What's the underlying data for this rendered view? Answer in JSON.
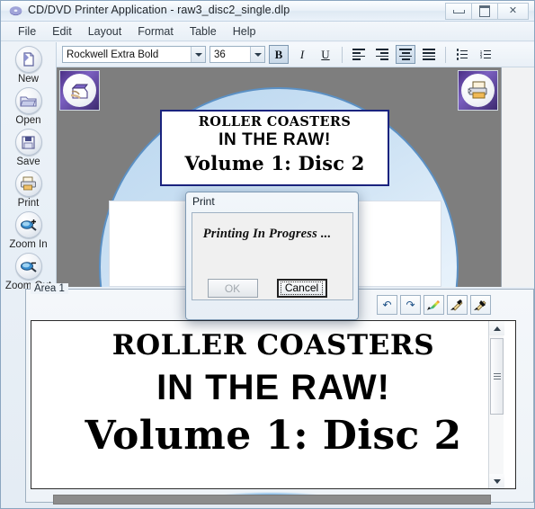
{
  "window": {
    "title": "CD/DVD Printer Application - raw3_disc2_single.dlp",
    "app_icon": "disc-icon",
    "minimize_label": "Minimize",
    "maximize_label": "Restore",
    "close_label": "✕"
  },
  "menubar": {
    "items": [
      {
        "label": "File"
      },
      {
        "label": "Edit"
      },
      {
        "label": "Layout"
      },
      {
        "label": "Format"
      },
      {
        "label": "Table"
      },
      {
        "label": "Help"
      }
    ]
  },
  "format_toolbar": {
    "font_family_value": "Rockwell Extra Bold",
    "font_size_value": "36",
    "bold_label": "B",
    "italic_label": "I",
    "underline_label": "U",
    "align_left": "align-left-icon",
    "align_right": "align-right-icon",
    "align_center": "align-center-icon",
    "align_justify": "align-justify-icon",
    "bullet_list": "bullet-list-icon",
    "numbered_list": "numbered-list-icon",
    "bold_active": true,
    "align_center_active": true
  },
  "sidebar": {
    "items": [
      {
        "label": "New",
        "icon": "new-document-icon"
      },
      {
        "label": "Open",
        "icon": "open-folder-icon"
      },
      {
        "label": "Save",
        "icon": "save-disk-icon"
      },
      {
        "label": "Print",
        "icon": "printer-icon"
      },
      {
        "label": "Zoom In",
        "icon": "zoom-in-icon"
      },
      {
        "label": "Zoom Out",
        "icon": "zoom-out-icon"
      }
    ]
  },
  "preview": {
    "left_icon": "import-image-icon",
    "right_icon": "printer-preview-icon",
    "disc_label_text": {
      "line1": "ROLLER COASTERS",
      "line2": "IN THE RAW!",
      "line3": "Volume 1: Disc 2"
    },
    "colors": {
      "background": "#7e7e7e",
      "disc_fill": "#cde2f4",
      "disc_border": "#5b90c4",
      "textbox_border": "#1a237e"
    }
  },
  "area_panel": {
    "legend": "Area 1",
    "toolbar": [
      {
        "name": "undo-button",
        "glyph": "↶"
      },
      {
        "name": "redo-button",
        "glyph": "↷"
      },
      {
        "name": "gradient-fill-button",
        "glyph": "◢"
      },
      {
        "name": "text-color-button",
        "glyph": "▼"
      },
      {
        "name": "fill-color-button",
        "glyph": "◆"
      }
    ],
    "editor_text": {
      "line1": "ROLLER COASTERS",
      "line2": "IN THE RAW!",
      "line3": "Volume 1: Disc 2"
    },
    "scroll_up": "scroll-up-arrow",
    "scroll_down": "scroll-down-arrow"
  },
  "print_dialog": {
    "title": "Print",
    "message": "Printing In Progress ...",
    "ok_label": "OK",
    "cancel_label": "Cancel",
    "ok_disabled": true,
    "cancel_focused": true
  }
}
